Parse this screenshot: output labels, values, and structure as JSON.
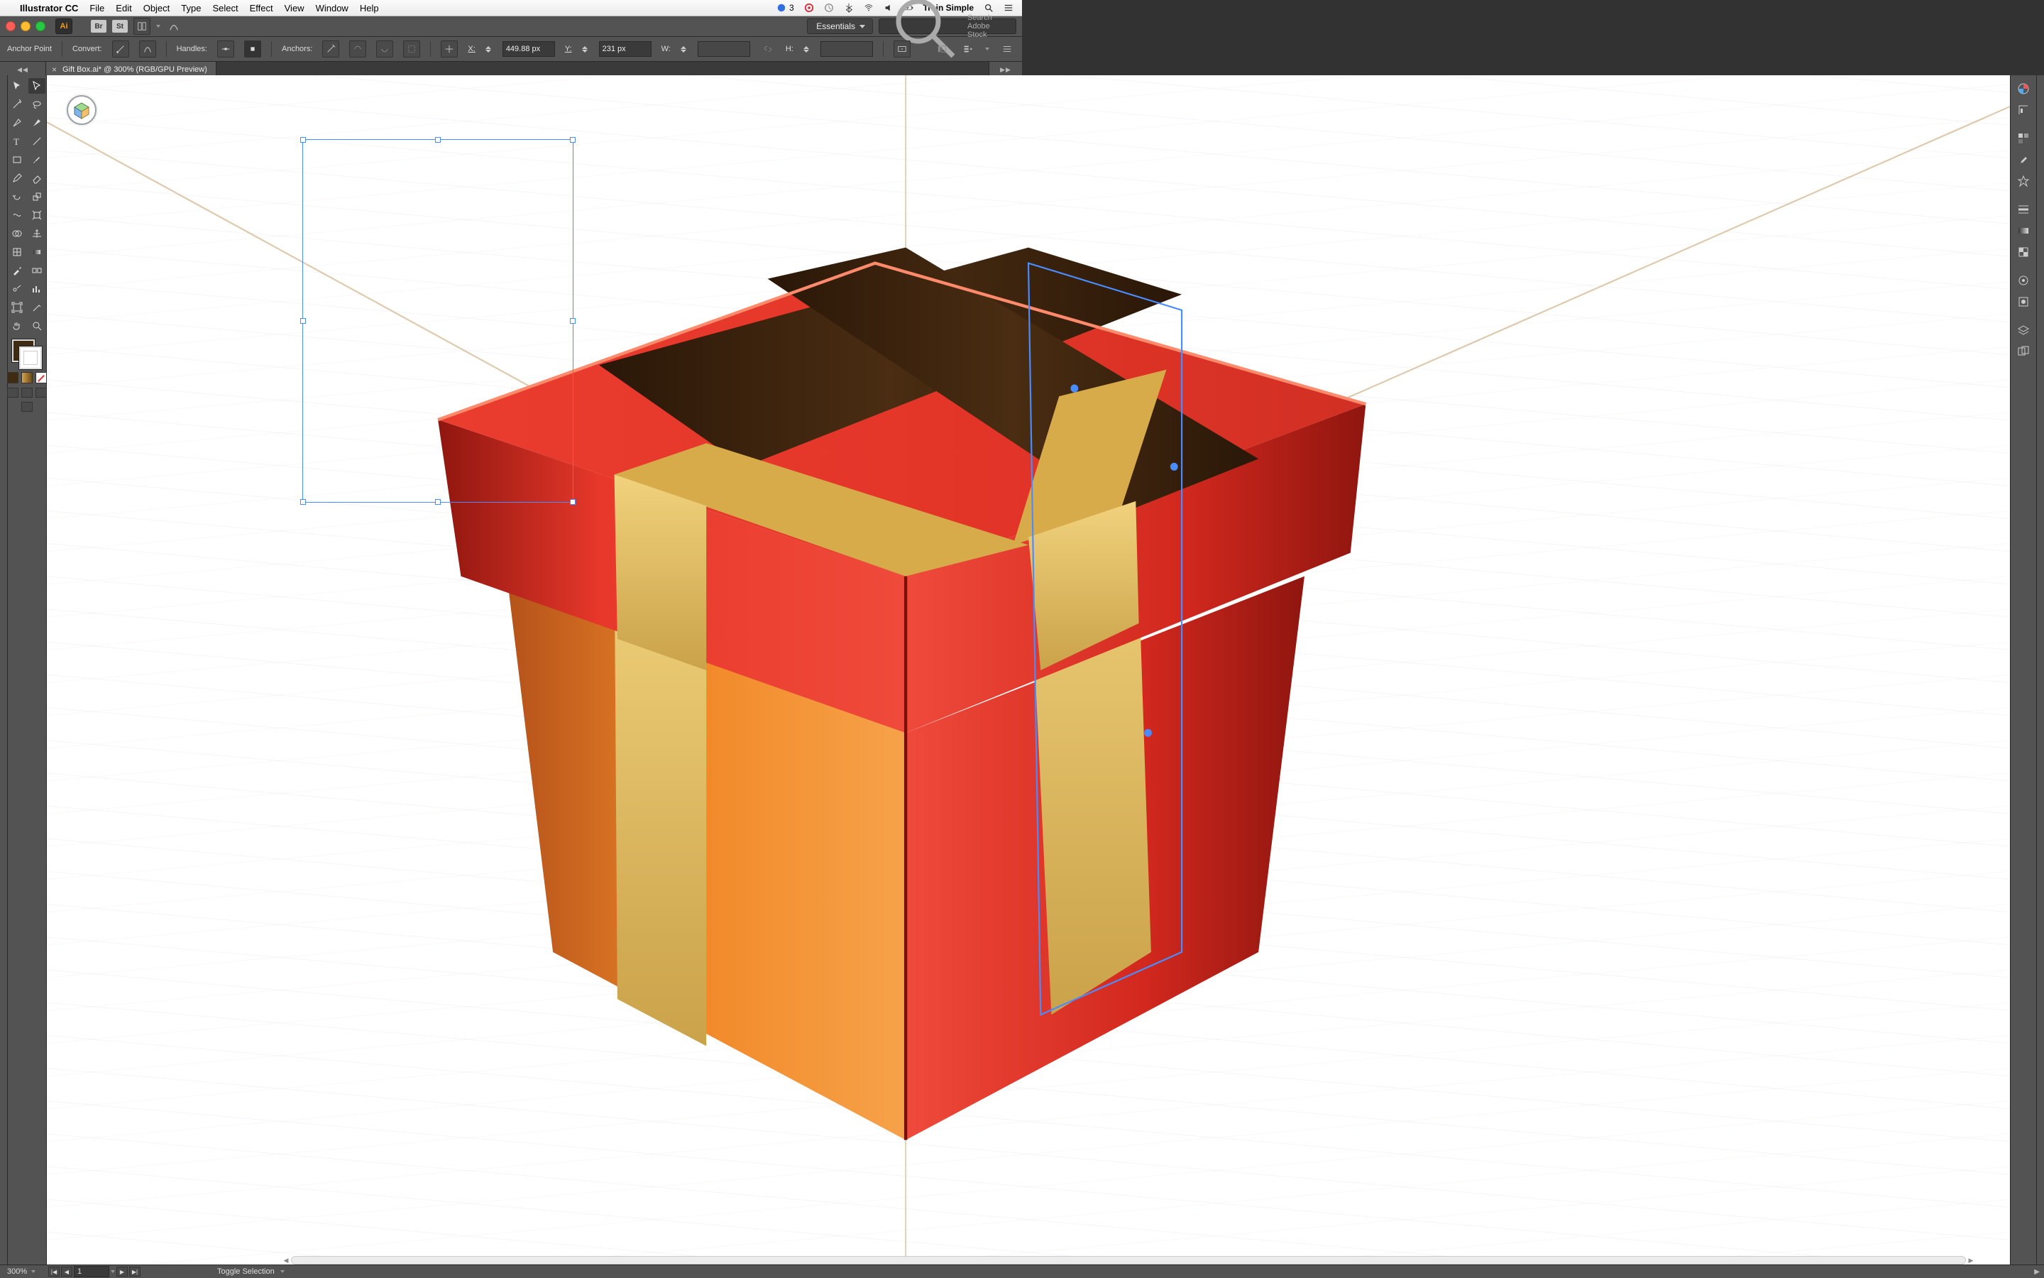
{
  "mac_menubar": {
    "app_name": "Illustrator CC",
    "menus": [
      "File",
      "Edit",
      "Object",
      "Type",
      "Select",
      "Effect",
      "View",
      "Window",
      "Help"
    ],
    "right_status": {
      "num_badge": "3",
      "account": "Train Simple"
    }
  },
  "app_bar": {
    "ai_badge": "Ai",
    "badges": [
      "Br",
      "St"
    ],
    "workspace_label": "Essentials",
    "search_placeholder": "Search Adobe Stock"
  },
  "control_bar": {
    "mode_label": "Anchor Point",
    "convert_label": "Convert:",
    "handles_label": "Handles:",
    "anchors_label": "Anchors:",
    "x_label": "X:",
    "x_value": "449.88 px",
    "y_label": "Y:",
    "y_value": "231 px",
    "w_label": "W:",
    "w_value": "",
    "h_label": "H:",
    "h_value": ""
  },
  "document_tab": {
    "title": "Gift Box.ai* @ 300% (RGB/GPU Preview)"
  },
  "status_bar": {
    "zoom": "300%",
    "artboard": "1",
    "tool_hint": "Toggle Selection"
  },
  "colors": {
    "fill": "#3f2a12",
    "box_red_light": "#ef3a2d",
    "box_red_dark": "#b5211a",
    "box_orange": "#f08a2a",
    "ribbon_gold": "#e8c06a",
    "ribbon_gold_dark": "#caa24a",
    "ribbon_brown": "#3b2411",
    "selection_blue": "#4a8cff"
  },
  "tools": {
    "left_column": [
      "selection-tool",
      "pen-tool",
      "curvature-tool",
      "type-tool",
      "rectangle-tool",
      "shape-builder-tool",
      "mesh-tool",
      "free-transform-tool",
      "blend-tool",
      "column-graph-tool",
      "eyedropper-tool",
      "artboard-tool",
      "hand-tool"
    ],
    "right_column": [
      "direct-selection-tool",
      "add-anchor-tool",
      "delete-anchor-tool",
      "line-segment-tool",
      "paintbrush-tool",
      "eraser-tool",
      "rotate-tool",
      "scale-tool",
      "width-tool",
      "gradient-tool",
      "symbol-sprayer-tool",
      "slice-tool",
      "zoom-tool"
    ]
  },
  "right_panels": [
    "color-panel",
    "swatches-panel",
    "brushes-panel",
    "stroke-panel",
    "symbols-panel",
    "appearance-panel",
    "graphic-styles-panel",
    "libraries-panel",
    "layers-panel",
    "artboards-panel"
  ]
}
